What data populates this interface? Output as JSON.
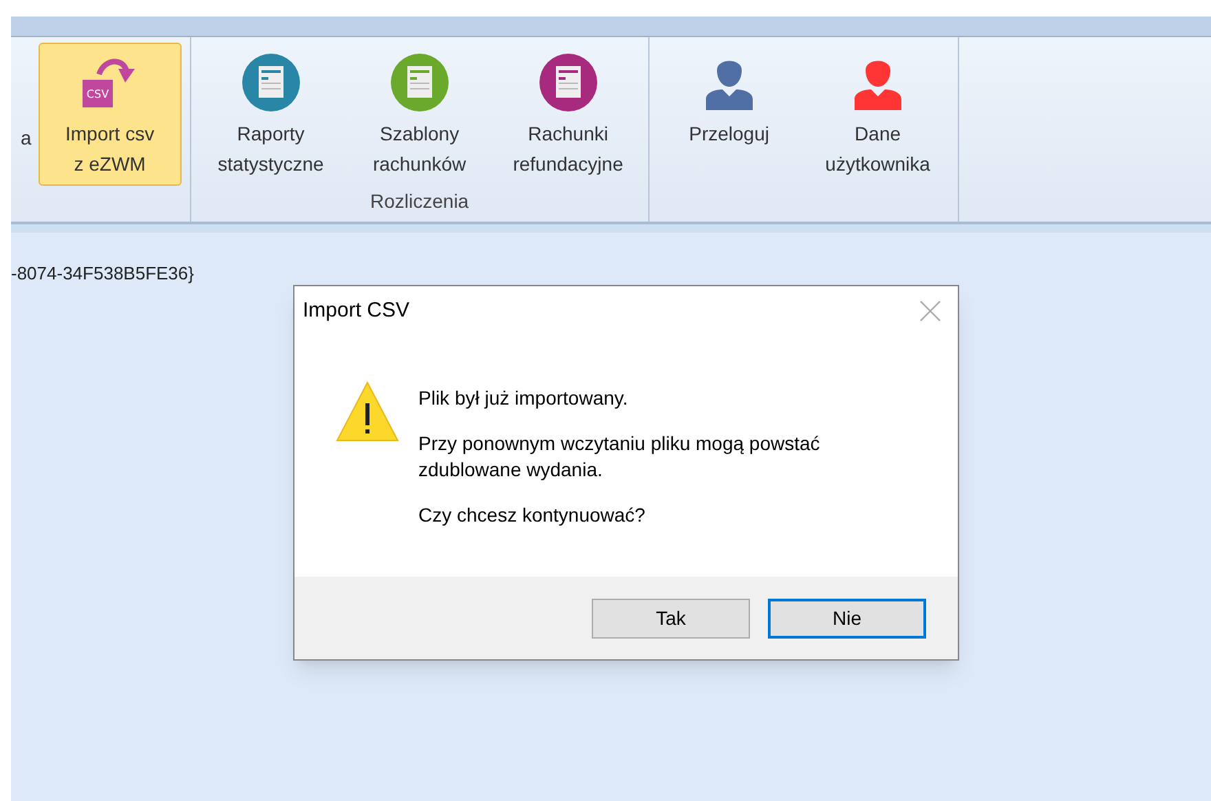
{
  "ribbon": {
    "groups": [
      {
        "items": [
          {
            "kind": "cut",
            "label": [
              "a"
            ],
            "selected": false
          },
          {
            "kind": "csv",
            "badge": "CSV",
            "label": [
              "Import csv",
              "z eZWM"
            ],
            "selected": true
          }
        ]
      },
      {
        "label": "Rozliczenia",
        "items": [
          {
            "kind": "doc",
            "color": "#2a86a6",
            "label": [
              "Raporty",
              "statystyczne"
            ],
            "selected": false
          },
          {
            "kind": "doc",
            "color": "#6aa92c",
            "label": [
              "Szablony",
              "rachunków"
            ],
            "selected": false
          },
          {
            "kind": "doc",
            "color": "#a72a7e",
            "label": [
              "Rachunki",
              "refundacyjne"
            ],
            "selected": false
          }
        ]
      },
      {
        "items": [
          {
            "kind": "user",
            "color": "#4f6fa5",
            "label": [
              "Przeloguj"
            ],
            "selected": false
          },
          {
            "kind": "user",
            "color": "#ff3535",
            "label": [
              "Dane",
              "użytkownika"
            ],
            "selected": false
          }
        ]
      }
    ]
  },
  "content": {
    "text": "-8074-34F538B5FE36}"
  },
  "dialog": {
    "title": "Import CSV",
    "paragraphs": [
      "Plik był już importowany.",
      "Przy ponownym wczytaniu pliku mogą powstać zdublowane wydania.",
      "Czy chcesz kontynuować?"
    ],
    "buttons": [
      {
        "label": "Tak",
        "focused": false
      },
      {
        "label": "Nie",
        "focused": true
      }
    ]
  }
}
